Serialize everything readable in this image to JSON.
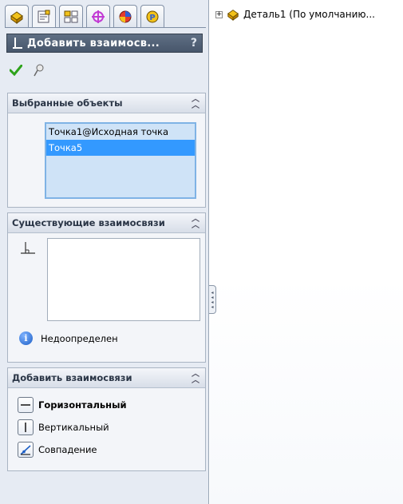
{
  "panel": {
    "tabs": [
      "feature-manager",
      "property-manager",
      "configuration-manager",
      "dimxpert-manager",
      "display-manager",
      "photoview"
    ],
    "title": "Добавить взаимосв...",
    "help_label": "?",
    "selected_group": {
      "header": "Выбранные объекты",
      "items": [
        {
          "label": "Точка1@Исходная точка",
          "selected": false
        },
        {
          "label": "Точка5",
          "selected": true
        }
      ]
    },
    "existing_group": {
      "header": "Существующие взаимосвязи",
      "status": "Недоопределен"
    },
    "add_group": {
      "header": "Добавить взаимосвязи",
      "relations": [
        {
          "label": "Горизонтальный",
          "icon": "horizontal-icon",
          "bold": true
        },
        {
          "label": "Вертикальный",
          "icon": "vertical-icon",
          "bold": false
        },
        {
          "label": "Совпадение",
          "icon": "coincident-icon",
          "bold": false
        }
      ]
    }
  },
  "tree": {
    "expander": "+",
    "part_label": "Деталь1  (По умолчанию..."
  },
  "colors": {
    "accent": "#3399ff",
    "title_bar": "#536277",
    "ok_check": "#2ea31b"
  }
}
